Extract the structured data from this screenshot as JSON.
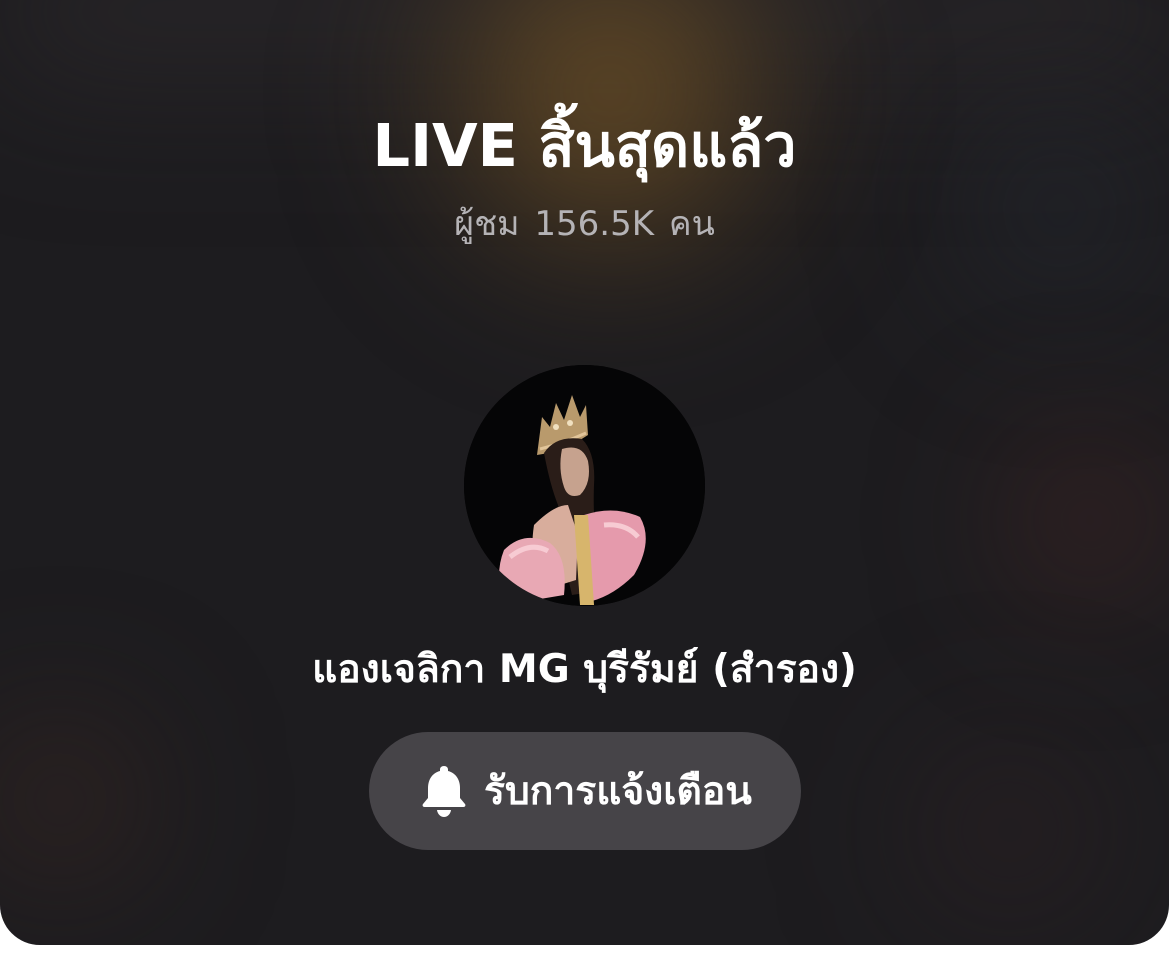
{
  "live_end": {
    "title": "LIVE สิ้นสุดแล้ว",
    "viewers_prefix": "ผู้ชม",
    "viewers_count": "156.5K",
    "viewers_suffix": "คน"
  },
  "host": {
    "avatar_icon": "host-avatar-photo",
    "name": "แองเจลิกา MG บุรีรัมย์ (สำรอง)"
  },
  "notify_button": {
    "icon": "bell-icon",
    "label": "รับการแจ้งเตือน"
  },
  "colors": {
    "background": "#1d1c1f",
    "title_text": "#ffffff",
    "secondary_text": "#b5b3b6",
    "button_bg": "#525054"
  }
}
